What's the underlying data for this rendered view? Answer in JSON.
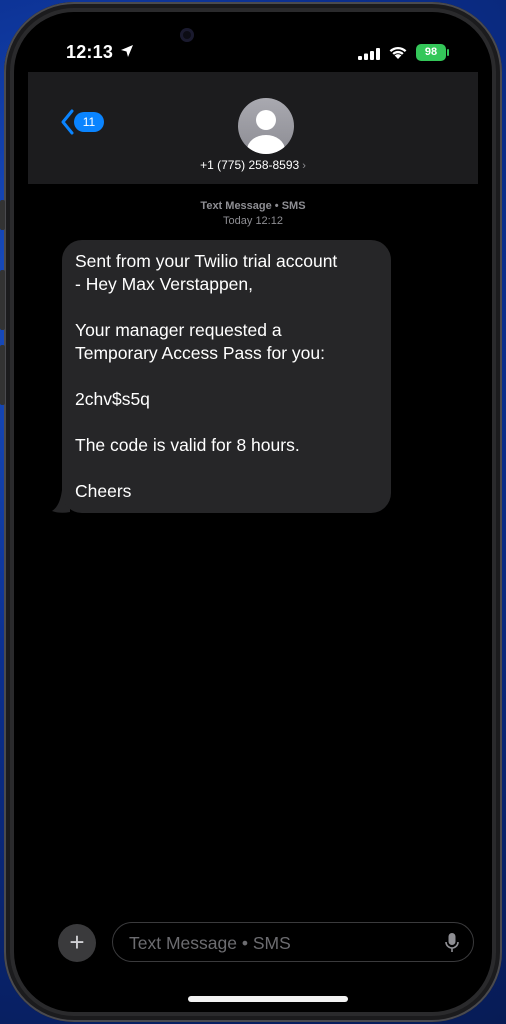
{
  "status_bar": {
    "time": "12:13",
    "battery_level": "98",
    "icons": [
      "location-arrow-icon",
      "cellular-signal-icon",
      "wifi-icon",
      "battery-icon"
    ]
  },
  "header": {
    "back_badge_count": "11",
    "contact_number": "+1 (775) 258-8593",
    "contact_chevron": "›"
  },
  "conversation": {
    "service_label": "Text Message • SMS",
    "timestamp": "Today 12:12",
    "messages": [
      {
        "lines": [
          "Sent from your Twilio trial account",
          "- Hey Max Verstappen,",
          "",
          "Your manager requested a",
          "Temporary Access Pass for you:",
          "",
          "2chv$s5q",
          "",
          "The code is valid for 8 hours.",
          "",
          "Cheers"
        ]
      }
    ]
  },
  "compose": {
    "add_glyph": "+",
    "placeholder": "Text Message • SMS"
  },
  "colors": {
    "accent": "#0a84ff",
    "bubble": "#262628",
    "header": "#1c1c1e",
    "battery": "#34c759"
  }
}
